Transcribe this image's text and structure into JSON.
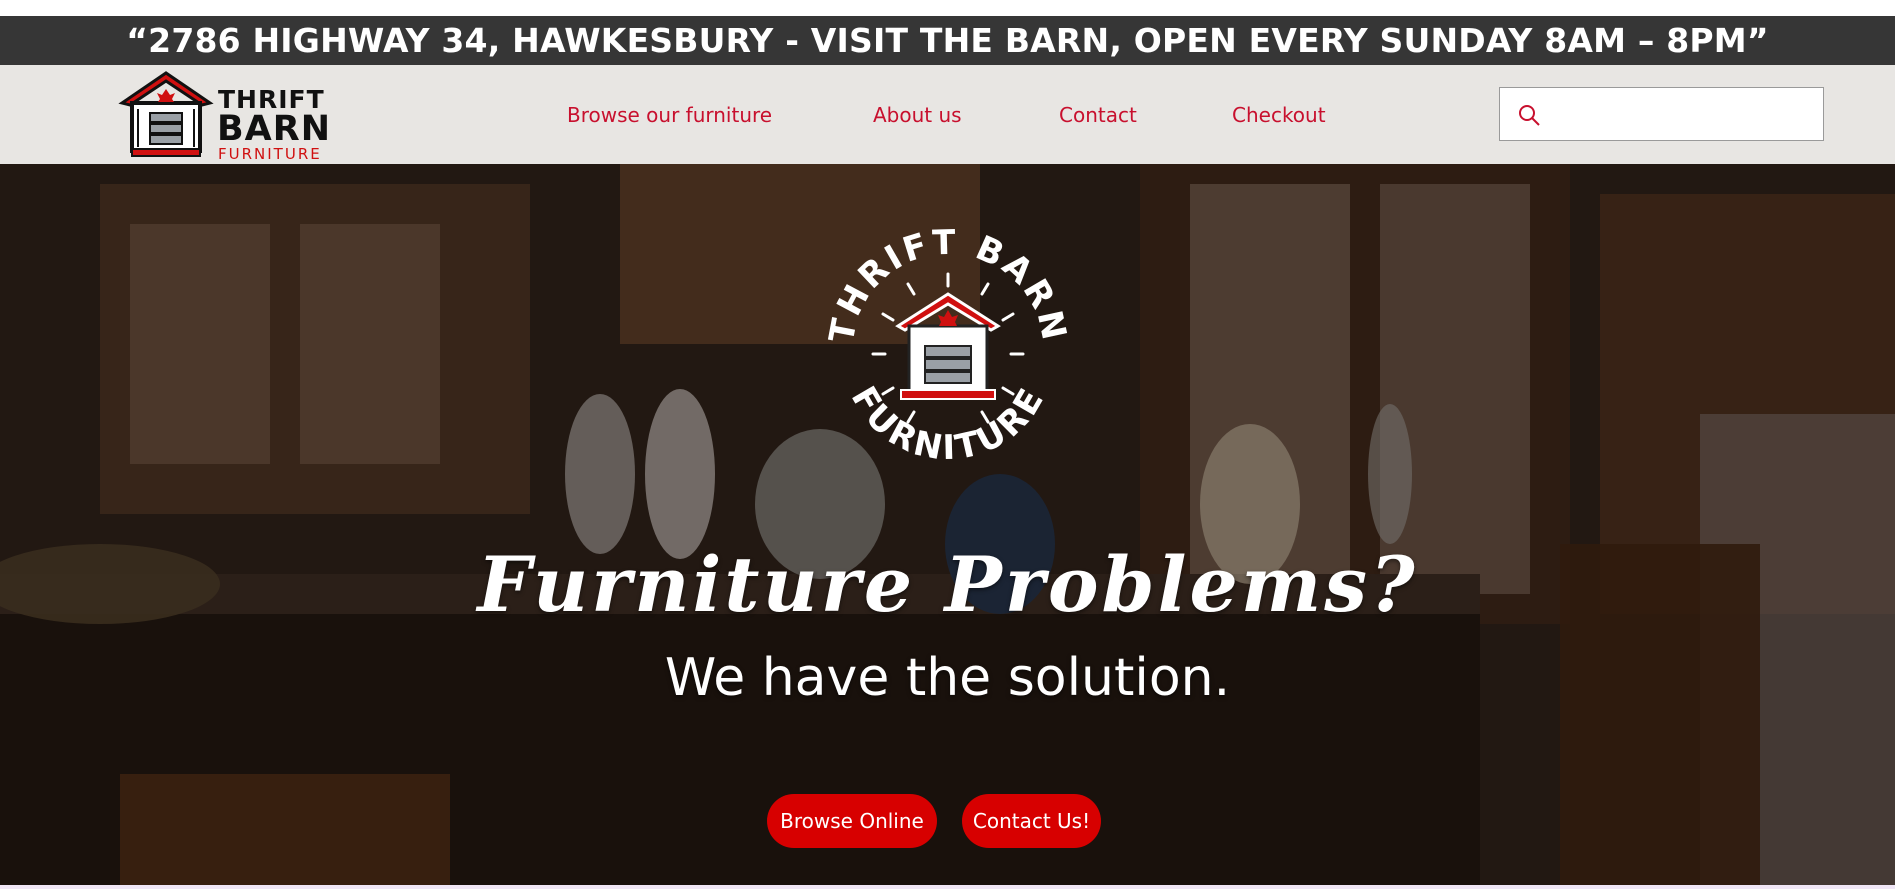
{
  "announcement": "“2786 HIGHWAY 34, HAWKESBURY - VISIT THE BARN, OPEN EVERY SUNDAY 8AM – 8PM”",
  "logo": {
    "line1": "THRIFT",
    "line2": "BARN",
    "line3": "FURNITURE"
  },
  "nav": {
    "items": [
      {
        "label": "Browse our furniture"
      },
      {
        "label": "About us"
      },
      {
        "label": "Contact"
      },
      {
        "label": "Checkout"
      }
    ]
  },
  "search": {
    "placeholder": "",
    "icon": "search-icon"
  },
  "hero": {
    "emblem_top": "THRIFT BARN",
    "emblem_bottom": "FURNITURE",
    "title": "Furniture Problems?",
    "subtitle": "We have the solution.",
    "buttons": [
      {
        "label": "Browse Online"
      },
      {
        "label": "Contact Us!"
      }
    ]
  },
  "colors": {
    "accent": "#d70000",
    "nav_link": "#c8102e",
    "announce_bg": "#363636",
    "header_bg": "#e8e6e3"
  }
}
